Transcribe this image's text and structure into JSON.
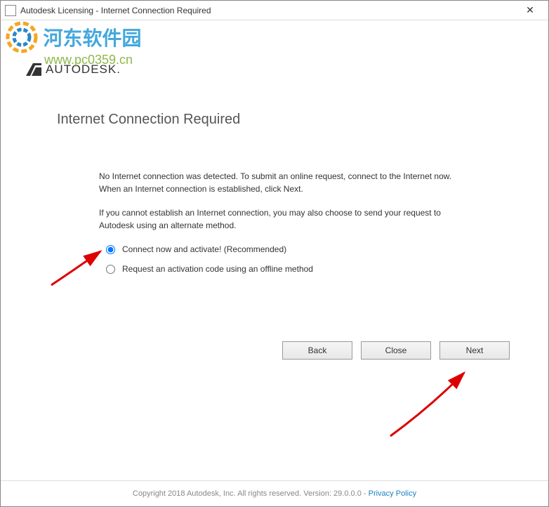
{
  "window": {
    "title": "Autodesk Licensing - Internet Connection Required"
  },
  "watermark": {
    "line1": "河东软件园",
    "line2": "www.pc0359.cn"
  },
  "brand": {
    "name": "AUTODESK."
  },
  "page": {
    "title": "Internet Connection Required",
    "para1": "No Internet connection was detected. To submit an online request, connect to the Internet now. When an Internet connection is established, click Next.",
    "para2": "If you cannot establish an Internet connection, you may also choose to send your request to Autodesk using an alternate method."
  },
  "options": {
    "opt1": "Connect now and activate! (Recommended)",
    "opt2": "Request an activation code using an offline method",
    "selected": "opt1"
  },
  "buttons": {
    "back": "Back",
    "close": "Close",
    "next": "Next"
  },
  "footer": {
    "copyright": "Copyright 2018 Autodesk, Inc. All rights reserved. Version: 29.0.0.0 - ",
    "privacy": "Privacy Policy"
  }
}
